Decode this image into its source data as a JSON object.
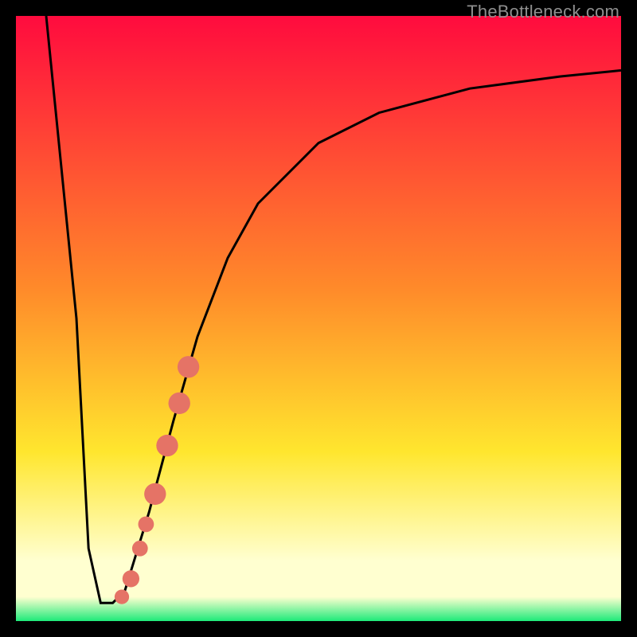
{
  "watermark": "TheBottleneck.com",
  "colors": {
    "top": "#ff0b3e",
    "mid1": "#ff8a2a",
    "mid2": "#ffe62e",
    "pale": "#ffffd0",
    "green": "#1dea79",
    "curve": "#000000",
    "marker": "#e57366"
  },
  "chart_data": {
    "type": "line",
    "title": "",
    "xlabel": "",
    "ylabel": "",
    "xlim": [
      0,
      100
    ],
    "ylim": [
      0,
      100
    ],
    "curve": [
      {
        "x": 5,
        "y": 100
      },
      {
        "x": 10,
        "y": 50
      },
      {
        "x": 12,
        "y": 12
      },
      {
        "x": 14,
        "y": 3
      },
      {
        "x": 16,
        "y": 3
      },
      {
        "x": 18,
        "y": 5
      },
      {
        "x": 22,
        "y": 18
      },
      {
        "x": 26,
        "y": 33
      },
      {
        "x": 30,
        "y": 47
      },
      {
        "x": 35,
        "y": 60
      },
      {
        "x": 40,
        "y": 69
      },
      {
        "x": 50,
        "y": 79
      },
      {
        "x": 60,
        "y": 84
      },
      {
        "x": 75,
        "y": 88
      },
      {
        "x": 90,
        "y": 90
      },
      {
        "x": 100,
        "y": 91
      }
    ],
    "markers": [
      {
        "x": 17.5,
        "y": 4,
        "r": 1.2
      },
      {
        "x": 19.0,
        "y": 7,
        "r": 1.4
      },
      {
        "x": 20.5,
        "y": 12,
        "r": 1.3
      },
      {
        "x": 21.5,
        "y": 16,
        "r": 1.3
      },
      {
        "x": 23.0,
        "y": 21,
        "r": 1.8
      },
      {
        "x": 25.0,
        "y": 29,
        "r": 1.8
      },
      {
        "x": 27.0,
        "y": 36,
        "r": 1.8
      },
      {
        "x": 28.5,
        "y": 42,
        "r": 1.8
      }
    ]
  }
}
